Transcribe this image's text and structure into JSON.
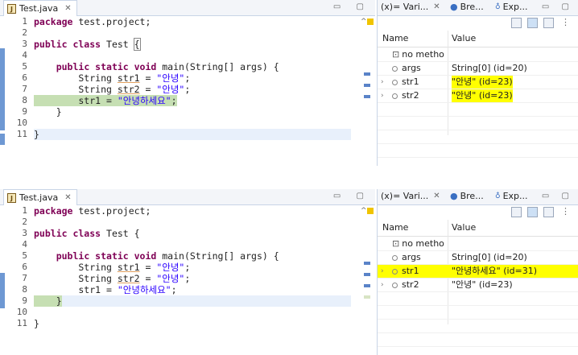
{
  "panels": [
    {
      "editor_tab": "Test.java",
      "lines": [
        "1",
        "2",
        "3",
        "4",
        "5",
        "6",
        "7",
        "8",
        "9",
        "10",
        "11"
      ],
      "code": [
        "package test.project;",
        "",
        "public class Test {",
        "",
        "    public static void main(String[] args) {",
        "        String str1 = \"안녕\";",
        "        String str2 = \"안녕\";",
        "        str1 = \"안녕하세요\";",
        "    }",
        "",
        "}"
      ],
      "vars_tabs": [
        "(x)= Vari...",
        "Bre...",
        "Exp..."
      ],
      "columns": {
        "name": "Name",
        "value": "Value"
      },
      "rows": [
        {
          "name": "no metho",
          "value": ""
        },
        {
          "name": "args",
          "value": "String[0]  (id=20)"
        },
        {
          "name": "str1",
          "value": "\"안녕\" (id=23)"
        },
        {
          "name": "str2",
          "value": "\"안녕\" (id=23)"
        }
      ]
    },
    {
      "editor_tab": "Test.java",
      "lines": [
        "1",
        "2",
        "3",
        "4",
        "5",
        "6",
        "7",
        "8",
        "9",
        "10",
        "11"
      ],
      "code": [
        "package test.project;",
        "",
        "public class Test {",
        "",
        "    public static void main(String[] args) {",
        "        String str1 = \"안녕\";",
        "        String str2 = \"안녕\";",
        "        str1 = \"안녕하세요\";",
        "    }",
        "",
        "}"
      ],
      "vars_tabs": [
        "(x)= Vari...",
        "Bre...",
        "Exp..."
      ],
      "columns": {
        "name": "Name",
        "value": "Value"
      },
      "rows": [
        {
          "name": "no metho",
          "value": ""
        },
        {
          "name": "args",
          "value": "String[0]  (id=20)"
        },
        {
          "name": "str1",
          "value": "\"안녕하세요\" (id=31)"
        },
        {
          "name": "str2",
          "value": "\"안녕\" (id=23)"
        }
      ]
    }
  ],
  "colors": {
    "highlight_yellow": "#ffff00",
    "current_line_green": "#c6dfb3",
    "keyword": "#7f0055",
    "string": "#2a00ff"
  }
}
